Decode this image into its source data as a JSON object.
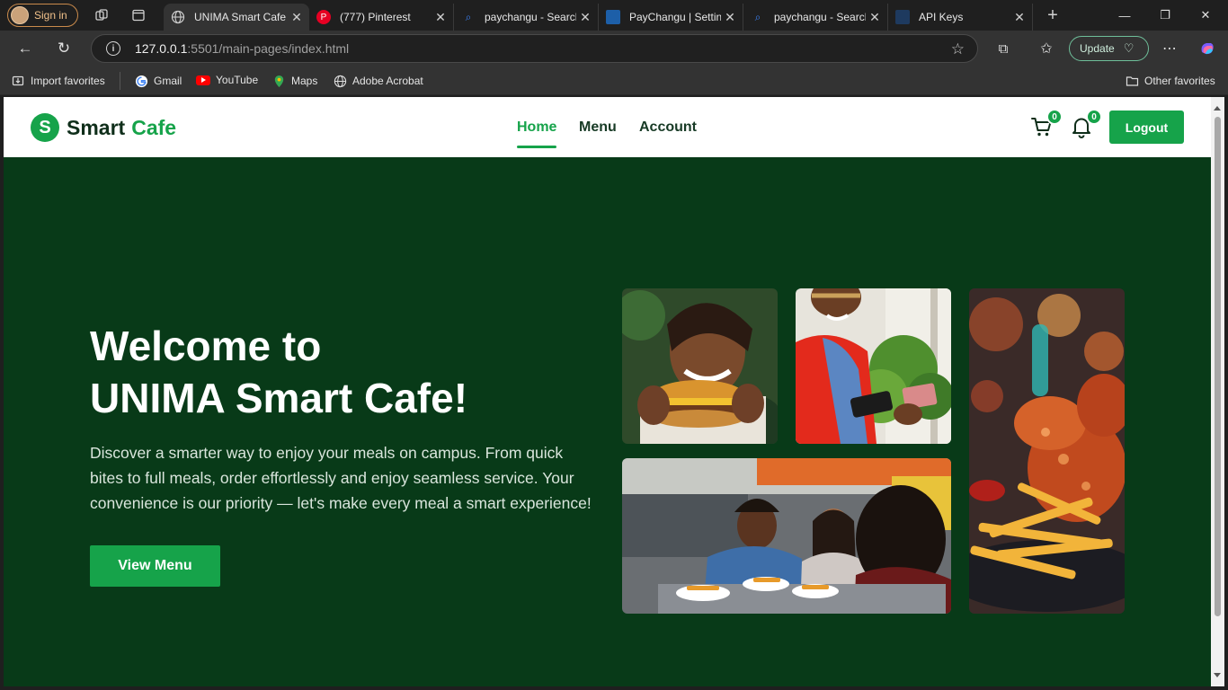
{
  "browser": {
    "profile_label": "Sign in",
    "tabs": [
      {
        "title": "UNIMA Smart Cafe",
        "icon": "globe-icon"
      },
      {
        "title": "(777) Pinterest",
        "icon": "pinterest-icon"
      },
      {
        "title": "paychangu - Search",
        "icon": "search-icon"
      },
      {
        "title": "PayChangu | Settings",
        "icon": "paychangu-icon"
      },
      {
        "title": "paychangu - Search",
        "icon": "search-icon"
      },
      {
        "title": "API Keys",
        "icon": "api-icon"
      }
    ],
    "url_host": "127.0.0.1",
    "url_rest": ":5501/main-pages/index.html",
    "update_label": "Update",
    "favorites": [
      {
        "label": "Import favorites",
        "icon": "import-icon"
      },
      {
        "label": "Gmail",
        "icon": "google-icon"
      },
      {
        "label": "YouTube",
        "icon": "youtube-icon"
      },
      {
        "label": "Maps",
        "icon": "maps-icon"
      },
      {
        "label": "Adobe Acrobat",
        "icon": "globe-icon"
      }
    ],
    "other_favorites": "Other favorites"
  },
  "site": {
    "logo_badge": "S",
    "logo_word1": "Smart",
    "logo_word2": "Cafe",
    "nav": [
      "Home",
      "Menu",
      "Account"
    ],
    "cart_count": "0",
    "notif_count": "0",
    "logout_label": "Logout",
    "accent_color": "#16a34a",
    "hero_bg": "#083a18"
  },
  "hero": {
    "title_line1": "Welcome to",
    "title_line2": "UNIMA Smart Cafe!",
    "description": "Discover a smarter way to enjoy your meals on campus. From quick bites to full meals, order effortlessly and enjoy seamless service. Your convenience is our priority — let's make every meal a smart experience!",
    "button_label": "View Menu"
  }
}
